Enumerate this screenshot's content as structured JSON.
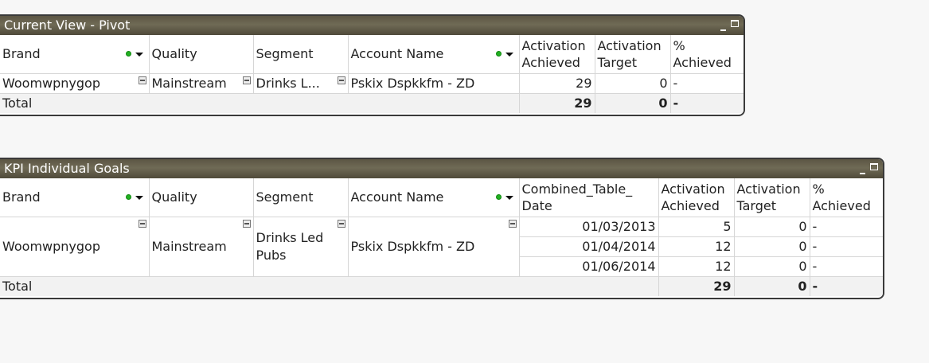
{
  "pivot": {
    "title": "Current View - Pivot",
    "headers": [
      "Brand",
      "Quality",
      "Segment",
      "Account Name",
      "Activation Achieved",
      "Activation Target",
      "% Achieved"
    ],
    "row": {
      "brand": "Woomwpnygop",
      "quality": "Mainstream",
      "segment": "Drinks L...",
      "account": "Pskix Dspkkfm - ZD",
      "achieved": "29",
      "target": "0",
      "pct": "-"
    },
    "total": {
      "label": "Total",
      "achieved": "29",
      "target": "0",
      "pct": "-"
    }
  },
  "kpi": {
    "title": "KPI Individual Goals",
    "headers": [
      "Brand",
      "Quality",
      "Segment",
      "Account Name",
      "Combined_Table_ Date",
      "Activation Achieved",
      "Activation Target",
      "% Achieved"
    ],
    "group": {
      "brand": "Woomwpnygop",
      "quality": "Mainstream",
      "segment": "Drinks Led Pubs",
      "account": "Pskix Dspkkfm - ZD"
    },
    "rows": [
      {
        "date": "01/03/2013",
        "achieved": "5",
        "target": "0",
        "pct": "-"
      },
      {
        "date": "01/04/2014",
        "achieved": "12",
        "target": "0",
        "pct": "-"
      },
      {
        "date": "01/06/2014",
        "achieved": "12",
        "target": "0",
        "pct": "-"
      }
    ],
    "total": {
      "label": "Total",
      "achieved": "29",
      "target": "0",
      "pct": "-"
    }
  },
  "colors": {
    "titlebar": "#5c5644",
    "border": "#3a3a3a",
    "filter_dot": "#22b022"
  }
}
